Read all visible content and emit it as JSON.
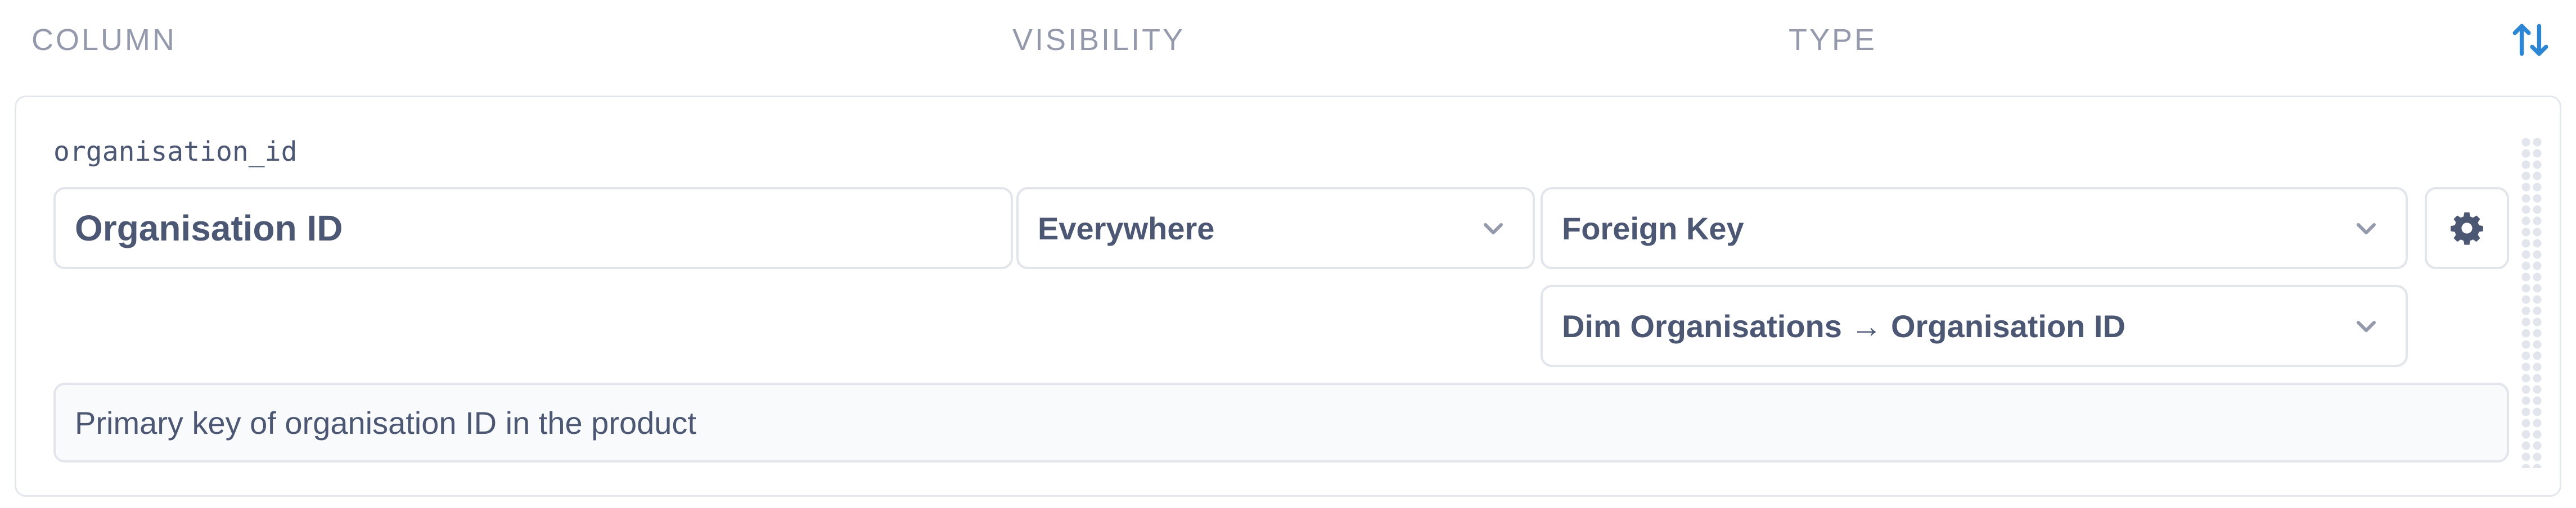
{
  "header": {
    "column_label": "COLUMN",
    "visibility_label": "VISIBILITY",
    "type_label": "TYPE",
    "sort_icon": "sort-arrows-icon"
  },
  "field": {
    "field_id": "organisation_id",
    "display_name": "Organisation ID",
    "visibility": "Everywhere",
    "semantic_type": "Foreign Key",
    "foreign_key_target": "Dim Organisations → Organisation ID",
    "description": "Primary key of organisation ID in the product",
    "settings_icon": "gear-icon",
    "chevron_icon": "chevron-down-icon",
    "drag_icon": "drag-handle-icon"
  },
  "colors": {
    "accent": "#2d86d4",
    "text": "#4c5773",
    "muted": "#949aab",
    "border": "#e2e5ec"
  }
}
